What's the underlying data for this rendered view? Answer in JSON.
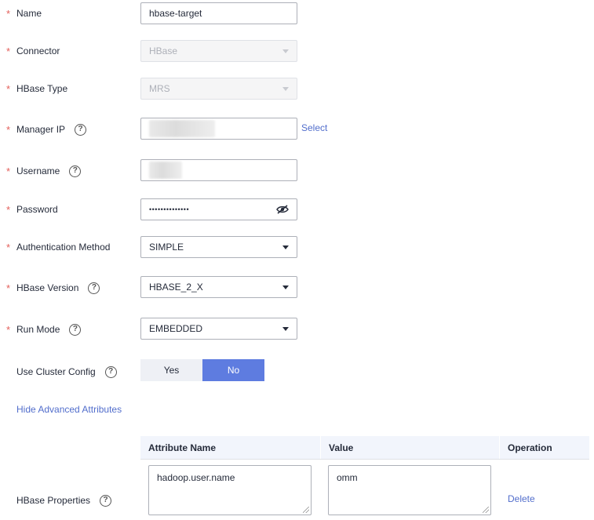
{
  "form": {
    "name": {
      "label": "Name",
      "value": "hbase-target"
    },
    "connector": {
      "label": "Connector",
      "value": "HBase"
    },
    "hbase_type": {
      "label": "HBase Type",
      "value": "MRS"
    },
    "manager_ip": {
      "label": "Manager IP",
      "select_link": "Select"
    },
    "username": {
      "label": "Username"
    },
    "password": {
      "label": "Password",
      "value": "••••••••••••••"
    },
    "auth_method": {
      "label": "Authentication Method",
      "value": "SIMPLE"
    },
    "hbase_version": {
      "label": "HBase Version",
      "value": "HBASE_2_X"
    },
    "run_mode": {
      "label": "Run Mode",
      "value": "EMBEDDED"
    },
    "use_cluster_config": {
      "label": "Use Cluster Config",
      "yes": "Yes",
      "no": "No",
      "selected": "No"
    },
    "advanced_toggle": "Hide Advanced Attributes",
    "hbase_properties": {
      "label": "HBase Properties",
      "columns": [
        "Attribute Name",
        "Value",
        "Operation"
      ],
      "rows": [
        {
          "name": "hadoop.user.name",
          "value": "omm",
          "operation": "Delete"
        }
      ]
    }
  },
  "colors": {
    "required": "#e45f5a",
    "accent": "#5e7ce0",
    "link": "#526ecc"
  }
}
